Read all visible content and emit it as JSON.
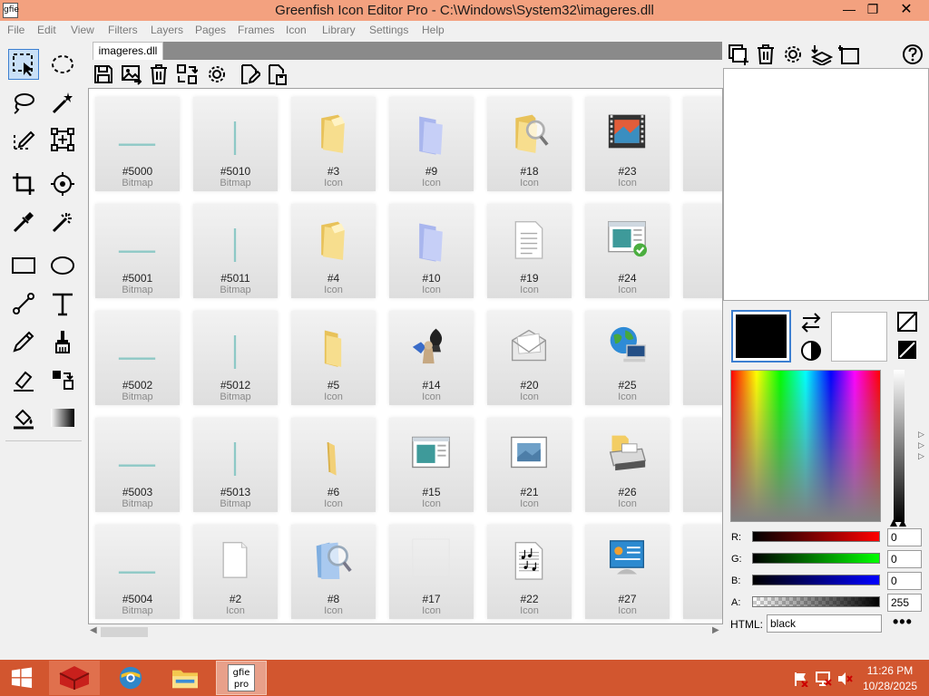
{
  "window": {
    "title": "Greenfish Icon Editor Pro - C:\\Windows\\System32\\imageres.dll",
    "app_icon_text": "gfie",
    "minimize": "—",
    "maximize": "❐",
    "close": "✕"
  },
  "menu": [
    "File",
    "Edit",
    "View",
    "Filters",
    "Layers",
    "Pages",
    "Frames",
    "Icon",
    "Library",
    "Settings",
    "Help"
  ],
  "tools": [
    "select-rectangle",
    "select-ellipse",
    "lasso",
    "magic-wand",
    "select-dashed-pencil",
    "transform",
    "crop",
    "target",
    "color-picker",
    "blur-brush",
    "rectangle",
    "ellipse",
    "line",
    "text",
    "pencil",
    "brush",
    "eraser",
    "color-replace",
    "fill-bucket",
    "gradient"
  ],
  "document": {
    "tab_label": "imageres.dll"
  },
  "grid": {
    "cells": [
      {
        "name": "#5000",
        "type": "Bitmap",
        "icon": "horizontal-line-bitmap"
      },
      {
        "name": "#5010",
        "type": "Bitmap",
        "icon": "vertical-line-bitmap"
      },
      {
        "name": "#3",
        "type": "Icon",
        "icon": "folder-open-icon"
      },
      {
        "name": "#9",
        "type": "Icon",
        "icon": "blue-folder-icon"
      },
      {
        "name": "#18",
        "type": "Icon",
        "icon": "folder-search-icon"
      },
      {
        "name": "#23",
        "type": "Icon",
        "icon": "video-film-icon"
      },
      {
        "name": "#",
        "type": "Ic",
        "icon": "partial-icon"
      },
      {
        "name": "#5001",
        "type": "Bitmap",
        "icon": "horizontal-line-bitmap"
      },
      {
        "name": "#5011",
        "type": "Bitmap",
        "icon": "vertical-line-bitmap"
      },
      {
        "name": "#4",
        "type": "Icon",
        "icon": "folder-open-icon"
      },
      {
        "name": "#10",
        "type": "Icon",
        "icon": "blue-folder-icon"
      },
      {
        "name": "#19",
        "type": "Icon",
        "icon": "document-icon"
      },
      {
        "name": "#24",
        "type": "Icon",
        "icon": "window-check-icon"
      },
      {
        "name": "#",
        "type": "Ic",
        "icon": "partial-icon"
      },
      {
        "name": "#5002",
        "type": "Bitmap",
        "icon": "horizontal-line-bitmap"
      },
      {
        "name": "#5012",
        "type": "Bitmap",
        "icon": "vertical-line-bitmap"
      },
      {
        "name": "#5",
        "type": "Icon",
        "icon": "folder-icon"
      },
      {
        "name": "#14",
        "type": "Icon",
        "icon": "games-icon"
      },
      {
        "name": "#20",
        "type": "Icon",
        "icon": "envelope-icon"
      },
      {
        "name": "#25",
        "type": "Icon",
        "icon": "globe-computer-icon"
      },
      {
        "name": "#",
        "type": "Ic",
        "icon": "partial-icon"
      },
      {
        "name": "#5003",
        "type": "Bitmap",
        "icon": "horizontal-line-bitmap"
      },
      {
        "name": "#5013",
        "type": "Bitmap",
        "icon": "vertical-line-bitmap"
      },
      {
        "name": "#6",
        "type": "Icon",
        "icon": "folder-narrow-icon"
      },
      {
        "name": "#15",
        "type": "Icon",
        "icon": "window-picture-icon"
      },
      {
        "name": "#21",
        "type": "Icon",
        "icon": "picture-frame-icon"
      },
      {
        "name": "#26",
        "type": "Icon",
        "icon": "printer-folder-icon"
      },
      {
        "name": "#",
        "type": "Ic",
        "icon": "partial-icon"
      },
      {
        "name": "#5004",
        "type": "Bitmap",
        "icon": "horizontal-line-bitmap"
      },
      {
        "name": "#2",
        "type": "Icon",
        "icon": "blank-page-icon"
      },
      {
        "name": "#8",
        "type": "Icon",
        "icon": "search-document-icon"
      },
      {
        "name": "#17",
        "type": "Icon",
        "icon": "empty-icon"
      },
      {
        "name": "#22",
        "type": "Icon",
        "icon": "music-sheet-icon"
      },
      {
        "name": "#27",
        "type": "Icon",
        "icon": "control-panel-icon"
      },
      {
        "name": "#",
        "type": "Ic",
        "icon": "partial-icon"
      }
    ]
  },
  "color": {
    "primary": "#000000",
    "secondary": "#ffffff",
    "r": "0",
    "g": "0",
    "b": "0",
    "a": "255",
    "html": "black",
    "labels": {
      "r": "R:",
      "g": "G:",
      "b": "B:",
      "a": "A:",
      "html": "HTML:"
    },
    "more": "•••"
  },
  "taskbar": {
    "time": "11:26 PM",
    "date": "10/28/2025",
    "gfie_label": "gfie pro"
  }
}
